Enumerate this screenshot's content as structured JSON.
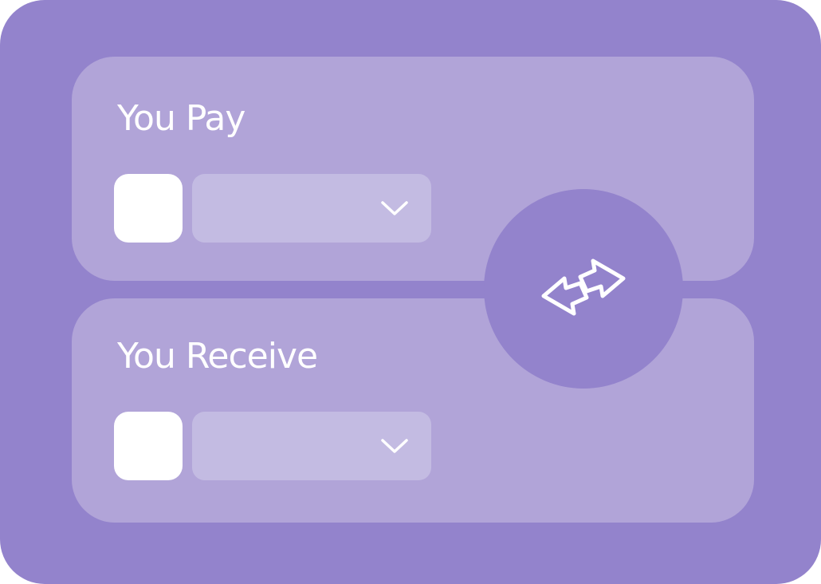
{
  "swap": {
    "pay": {
      "title": "You Pay",
      "selected_token": "",
      "icon": "token-placeholder-icon"
    },
    "receive": {
      "title": "You Receive",
      "selected_token": "",
      "icon": "token-placeholder-icon"
    },
    "swap_icon": "swap-arrows-icon"
  },
  "colors": {
    "card_background": "#9383cc",
    "panel_background": "#b1a4d8",
    "select_background": "#c3bbe2",
    "text": "#ffffff"
  }
}
